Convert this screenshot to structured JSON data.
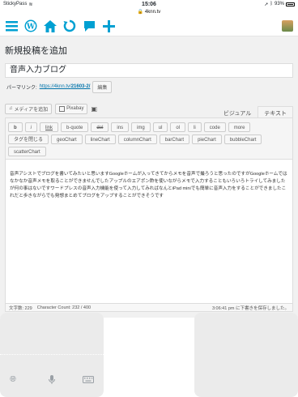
{
  "status_bar": {
    "app": "StickyPass",
    "time": "15:06",
    "battery": "93%"
  },
  "browser": {
    "url": "4knn.tv",
    "lock_glyph": "🔒"
  },
  "toolbar": {
    "icons": [
      "menu-icon",
      "wordpress-icon",
      "home-icon",
      "refresh-icon",
      "comment-icon",
      "add-icon",
      "avatar"
    ]
  },
  "page": {
    "title": "新規投稿を追加"
  },
  "post": {
    "title_value": "音声入力ブログ",
    "permalink_label": "パーマリンク:",
    "permalink_base": "https://4knn.tv/",
    "permalink_slug": "21603-2/",
    "edit_button": "編集"
  },
  "media": {
    "add_media": "メディアを追加",
    "pixabay": "Pixabay"
  },
  "editor": {
    "tab_visual": "ビジュアル",
    "tab_text": "テキスト",
    "active_tab": "text",
    "quicktags": [
      "b",
      "i",
      "link",
      "b-quote",
      "del",
      "ins",
      "img",
      "ul",
      "ol",
      "li",
      "code",
      "more",
      "タグを閉じる",
      "geoChart",
      "lineChart",
      "columnChart",
      "barChart",
      "pieChart",
      "bubbleChart",
      "scatterChart"
    ],
    "content": "音声アシストでブログを書いてみたいと思いますGoogleホームが入ってきてからメモを音声で撮ろうと思ったのですがGoogleホームではなかなか音声メモを取ることができませんでしたアップルのエアポン酢を使いながらメモで入力することもいろいろトライしてみましたが何の事はないですワードプレスの音声入力機能を使って入力してみればなんとiPad miniでも簡単に音声入力をすることができましたこれだと歩きながらでも発想まとめてブログをアップすることができそうです"
  },
  "editor_status": {
    "word_count": "文字数: 229",
    "char_count": "Character Count: 232 / 400",
    "autosave": "3:06:41 pm に下書きを保存しました。"
  }
}
